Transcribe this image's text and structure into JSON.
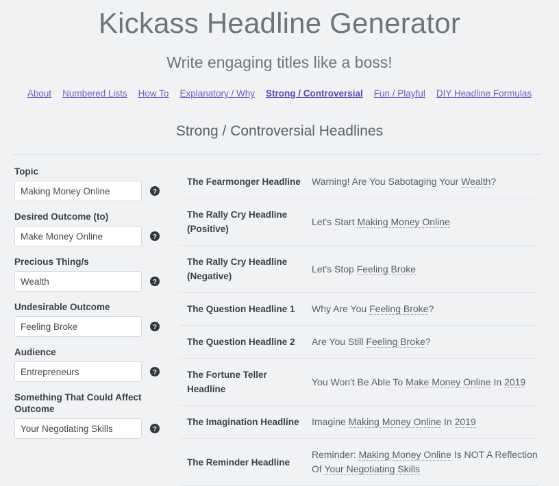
{
  "site": {
    "title": "Kickass Headline Generator",
    "tagline": "Write engaging titles like a boss!"
  },
  "nav": {
    "items": [
      {
        "label": "About",
        "active": false
      },
      {
        "label": "Numbered Lists",
        "active": false
      },
      {
        "label": "How To",
        "active": false
      },
      {
        "label": "Explanatory / Why",
        "active": false
      },
      {
        "label": "Strong / Controversial",
        "active": true
      },
      {
        "label": "Fun / Playful",
        "active": false
      },
      {
        "label": "DIY Headline Formulas",
        "active": false
      }
    ]
  },
  "section": {
    "heading": "Strong / Controversial Headlines"
  },
  "form": {
    "fields": [
      {
        "label": "Topic",
        "value": "Making Money Online",
        "name": "topic"
      },
      {
        "label": "Desired Outcome (to)",
        "value": "Make Money Online",
        "name": "desired-outcome"
      },
      {
        "label": "Precious Thing/s",
        "value": "Wealth",
        "name": "precious-thing"
      },
      {
        "label": "Undesirable Outcome",
        "value": "Feeling Broke",
        "name": "undesirable-outcome"
      },
      {
        "label": "Audience",
        "value": "Entrepreneurs",
        "name": "audience"
      },
      {
        "label": "Something That Could Affect Outcome",
        "value": "Your Negotiating Skills",
        "name": "affecting-factor"
      }
    ],
    "help_icon": "help-circle-icon"
  },
  "results": {
    "rows": [
      {
        "name": "The Fearmonger Headline",
        "value": "Warning! Are You Sabotaging Your Wealth?",
        "parts": [
          {
            "text": "Warning! Are You Sabotaging Your ",
            "variable": false
          },
          {
            "text": "Wealth",
            "variable": true
          },
          {
            "text": "?",
            "variable": false
          }
        ]
      },
      {
        "name": "The Rally Cry Headline (Positive)",
        "value": "Let's Start Making Money Online",
        "parts": [
          {
            "text": "Let's Start ",
            "variable": false
          },
          {
            "text": "Making Money Online",
            "variable": true
          }
        ]
      },
      {
        "name": "The Rally Cry Headline (Negative)",
        "value": "Let's Stop Feeling Broke",
        "parts": [
          {
            "text": "Let's Stop ",
            "variable": false
          },
          {
            "text": "Feeling Broke",
            "variable": true
          }
        ]
      },
      {
        "name": "The Question Headline 1",
        "value": "Why Are You Feeling Broke?",
        "parts": [
          {
            "text": "Why Are You ",
            "variable": false
          },
          {
            "text": "Feeling Broke",
            "variable": true
          },
          {
            "text": "?",
            "variable": false
          }
        ]
      },
      {
        "name": "The Question Headline 2",
        "value": "Are You Still Feeling Broke?",
        "parts": [
          {
            "text": "Are You Still ",
            "variable": false
          },
          {
            "text": "Feeling Broke",
            "variable": true
          },
          {
            "text": "?",
            "variable": false
          }
        ]
      },
      {
        "name": "The Fortune Teller Headline",
        "value": "You Won't Be Able To Make Money Online In 2019",
        "parts": [
          {
            "text": "You Won't Be Able To ",
            "variable": false
          },
          {
            "text": "Make Money Online",
            "variable": true
          },
          {
            "text": " In ",
            "variable": false
          },
          {
            "text": "2019",
            "variable": true
          }
        ]
      },
      {
        "name": "The Imagination Headline",
        "value": "Imagine Making Money Online In 2019",
        "parts": [
          {
            "text": "Imagine ",
            "variable": false
          },
          {
            "text": "Making Money Online",
            "variable": true
          },
          {
            "text": " In ",
            "variable": false
          },
          {
            "text": "2019",
            "variable": true
          }
        ]
      },
      {
        "name": "The Reminder Headline",
        "value": "Reminder: Making Money Online Is NOT A Reflection Of Your Negotiating Skills",
        "parts": [
          {
            "text": "Reminder: ",
            "variable": false
          },
          {
            "text": "Making Money Online",
            "variable": true
          },
          {
            "text": " Is NOT A Reflection Of ",
            "variable": false
          },
          {
            "text": "Your Negotiating Skills",
            "variable": true
          }
        ]
      }
    ]
  },
  "colors": {
    "page_background": "#f1f2f4",
    "link": "#6f5fc0",
    "title": "#6c757d",
    "label": "#39414a",
    "value_text": "#595f66",
    "divider": "#e2e5e8",
    "input_border": "#d5d9dd"
  }
}
